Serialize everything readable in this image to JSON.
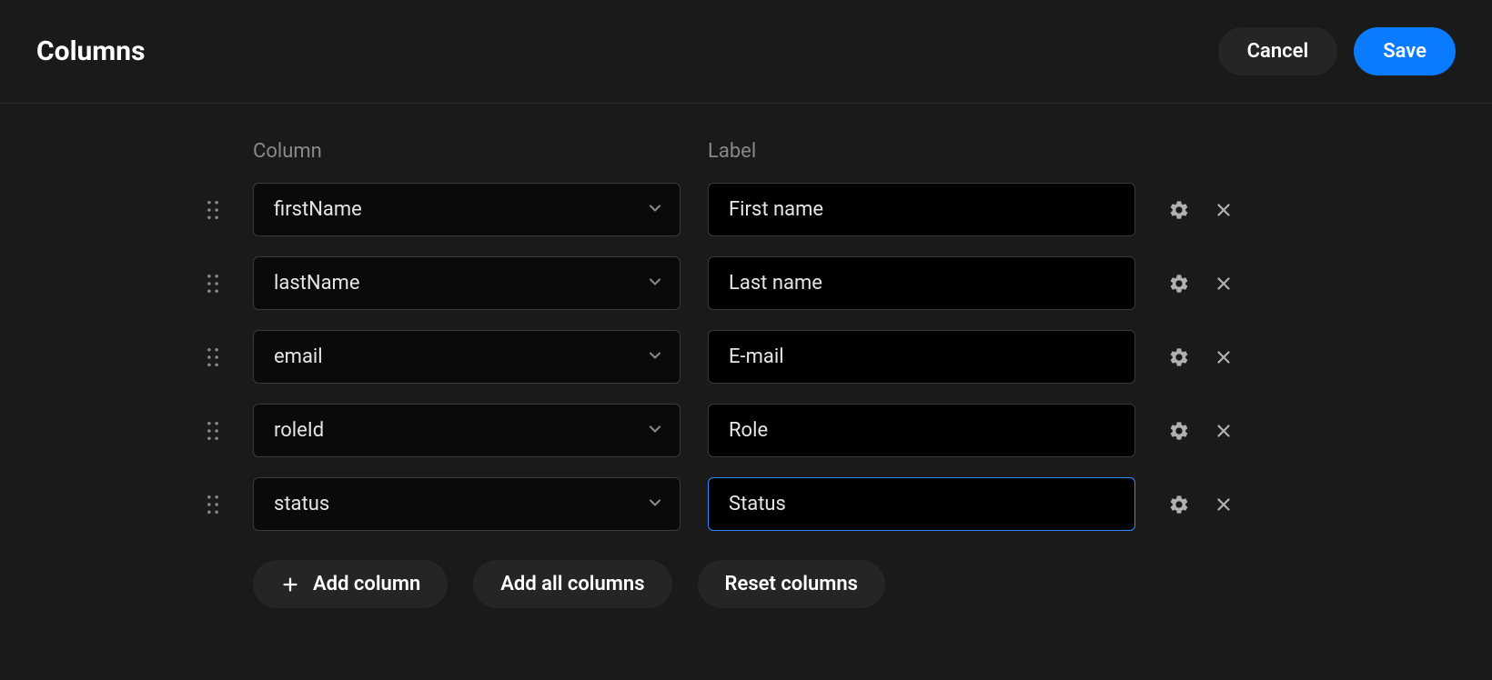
{
  "header": {
    "title": "Columns",
    "cancel_label": "Cancel",
    "save_label": "Save"
  },
  "table_headers": {
    "column": "Column",
    "label": "Label"
  },
  "rows": [
    {
      "column": "firstName",
      "label": "First name",
      "focused": false
    },
    {
      "column": "lastName",
      "label": "Last name",
      "focused": false
    },
    {
      "column": "email",
      "label": "E-mail",
      "focused": false
    },
    {
      "column": "roleId",
      "label": "Role",
      "focused": false
    },
    {
      "column": "status",
      "label": "Status",
      "focused": true
    }
  ],
  "footer": {
    "add_column": "Add column",
    "add_all_columns": "Add all columns",
    "reset_columns": "Reset columns"
  }
}
